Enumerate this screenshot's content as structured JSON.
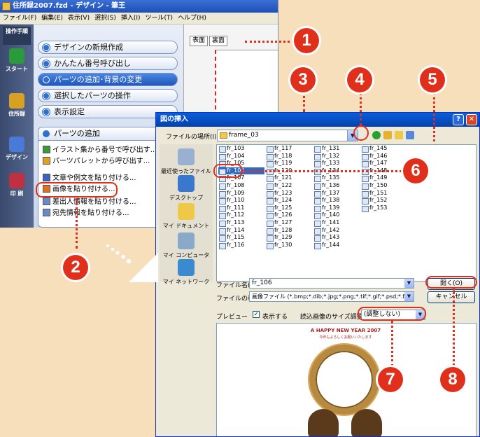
{
  "app": {
    "title": "住所録2007.fzd - デザイン - 筆王",
    "menu": [
      "ファイル(F)",
      "編集(E)",
      "表示(V)",
      "選択(S)",
      "挿入(I)",
      "ツール(T)",
      "ヘルプ(H)"
    ],
    "left_strip": {
      "header": "操作手順",
      "items": [
        "スタート",
        "住所録",
        "デザイン",
        "印 刷"
      ]
    },
    "wizard": {
      "steps": [
        "デザインの新規作成",
        "かんたん番号呼び出し",
        "パーツの追加･背景の変更",
        "選択したパーツの操作",
        "表示設定"
      ],
      "active_step": "パーツの追加･背景の変更",
      "parts_panel_title": "パーツの追加",
      "parts_items": [
        "イラスト集から番号で呼び出す...",
        "パーツパレットから呼び出す...",
        "文章や例文を貼り付ける...",
        "画像を貼り付ける...",
        "差出人情報を貼り付ける...",
        "宛先情報を貼り付ける..."
      ]
    },
    "tabs": [
      "表面",
      "裏面"
    ]
  },
  "dialog": {
    "title": "図の挿入",
    "lookin_label": "ファイルの場所(I):",
    "lookin_value": "frame_03",
    "places": [
      "最近使ったファイル",
      "デスクトップ",
      "マイ ドキュメント",
      "マイ コンピュータ",
      "マイ ネットワーク"
    ],
    "files": [
      [
        "fr_103",
        "fr_104",
        "fr_105",
        "fr_106",
        "fr_107",
        "fr_108",
        "fr_109",
        "fr_110",
        "fr_111",
        "fr_112",
        "fr_113",
        "fr_114",
        "fr_115",
        "fr_116"
      ],
      [
        "fr_117",
        "fr_118",
        "fr_119",
        "fr_120",
        "fr_121",
        "fr_122",
        "fr_123",
        "fr_124",
        "fr_125",
        "fr_126",
        "fr_127",
        "fr_128",
        "fr_129",
        "fr_130"
      ],
      [
        "fr_131",
        "fr_132",
        "fr_133",
        "fr_134",
        "fr_135",
        "fr_136",
        "fr_137",
        "fr_138",
        "fr_139",
        "fr_140",
        "fr_141",
        "fr_142",
        "fr_143",
        "fr_144"
      ],
      [
        "fr_145",
        "fr_146",
        "fr_147",
        "fr_148",
        "fr_149",
        "fr_150",
        "fr_151",
        "fr_152",
        "fr_153"
      ]
    ],
    "selected_file": "fr_106",
    "filename_label": "ファイル名(N):",
    "filename_value": "fr_106",
    "filetype_label": "ファイルの種類(T):",
    "filetype_value": "画像ファイル (*.bmp;*.dib;*.jpg;*.png;*.tif;*.gif;*.psd;*.fp",
    "open_button": "開く(O)",
    "cancel_button": "キャンセル",
    "preview_label": "プレビュー",
    "show_label": "表示する",
    "show_checked": true,
    "size_label": "読込画像のサイズ調整:",
    "size_value": "(調整しない)",
    "card_title": "A HAPPY NEW YEAR 2007",
    "card_sub": "今年もよろしくお願いいたします"
  },
  "annotations": [
    "1",
    "2",
    "3",
    "4",
    "5",
    "6",
    "7",
    "8"
  ],
  "colors": {
    "annotation": "#e0301c",
    "background": "#f6dfba",
    "titlebar": "#0a5fd8",
    "selection": "#316ac5"
  }
}
